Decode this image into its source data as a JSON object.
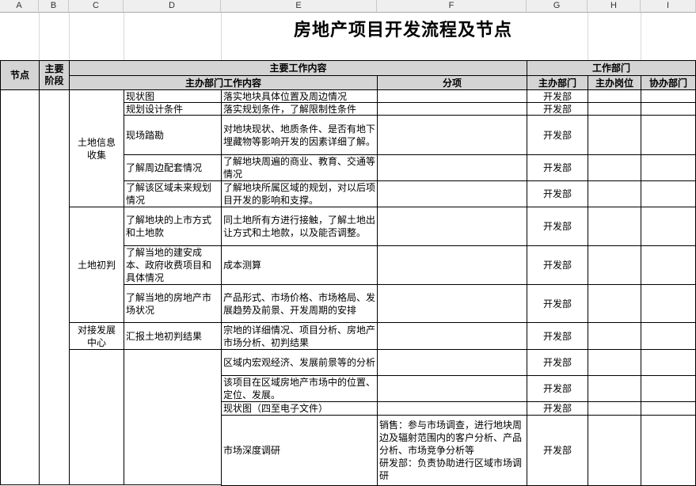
{
  "columns": [
    "A",
    "B",
    "C",
    "D",
    "E",
    "F",
    "G",
    "H",
    "I"
  ],
  "title": "房地产项目开发流程及节点",
  "headers": {
    "node": "节点",
    "stage": "主要阶段",
    "main_work": "主要工作内容",
    "dept": "工作部门",
    "host_dept_work": "主办部门工作内容",
    "sub_item": "分项",
    "host_dept": "主办部门",
    "host_post": "主办岗位",
    "assist_dept": "协办部门"
  },
  "groups": [
    {
      "label": "土地信息收集"
    },
    {
      "label": "土地初判"
    },
    {
      "label": "对接发展中心"
    }
  ],
  "rows": [
    {
      "item": "现状图",
      "desc": "落实地块具体位置及周边情况",
      "sub": "",
      "dept": "开发部"
    },
    {
      "item": "规划设计条件",
      "desc": "落实规划条件，了解限制性条件",
      "sub": "",
      "dept": "开发部"
    },
    {
      "item": "现场踏勘",
      "desc": "对地块现状、地质条件、是否有地下埋藏物等影响开发的因素详细了解。",
      "sub": "",
      "dept": "开发部"
    },
    {
      "item": "了解周边配套情况",
      "desc": "了解地块周遍的商业、教育、交通等情况",
      "sub": "",
      "dept": "开发部"
    },
    {
      "item": "了解该区域未来规划情况",
      "desc": "了解地块所属区域的规划，对以后项目开发的影响和支撑。",
      "sub": "",
      "dept": "开发部"
    },
    {
      "item": "了解地块的上市方式和土地款",
      "desc": "同土地所有方进行接触，了解土地出让方式和土地款，以及能否调整。",
      "sub": "",
      "dept": "开发部"
    },
    {
      "item": "了解当地的建安成本、政府收费项目和具体情况",
      "desc": "成本测算",
      "sub": "",
      "dept": "开发部"
    },
    {
      "item": "了解当地的房地产市场状况",
      "desc": "产品形式、市场价格、市场格局、发展趋势及前景、开发周期的安排",
      "sub": "",
      "dept": "开发部"
    },
    {
      "item": "汇报土地初判结果",
      "desc": "宗地的详细情况、项目分析、房地产市场分析、初判结果",
      "sub": "",
      "dept": "开发部"
    },
    {
      "item": "",
      "desc": "区域内宏观经济、发展前景等的分析",
      "sub": "",
      "dept": "开发部"
    },
    {
      "item": "",
      "desc": "该项目在区域房地产市场中的位置、定位、发展。",
      "sub": "",
      "dept": "开发部"
    },
    {
      "item": "",
      "desc": "现状图（四至电子文件）",
      "sub": "",
      "dept": "开发部"
    },
    {
      "item": "",
      "desc": "市场深度调研",
      "sub": "销售：参与市场调查，进行地块周边及辐射范围内的客户分析、产品分析、市场竞争分析等\n研发部：负责协助进行区域市场调研",
      "dept": "开发部"
    }
  ]
}
